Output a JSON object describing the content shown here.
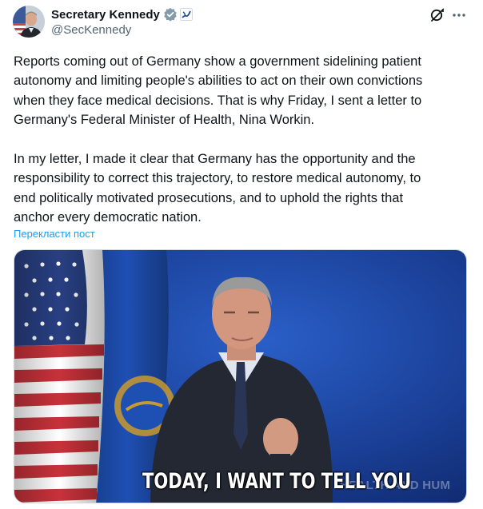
{
  "author": {
    "display_name": "Secretary Kennedy",
    "handle": "@SecKennedy",
    "avatar_icon": "profile-photo",
    "verified_icon": "verified-badge-icon",
    "affiliation_icon": "hhs-affiliation-badge-icon"
  },
  "actions": {
    "grok_icon": "grok-icon",
    "more_icon": "more-options-icon"
  },
  "tweet": {
    "text": "Reports coming out of Germany show a government sidelining patient\nautonomy and limiting people's abilities to act on their own convictions\nwhen they face medical decisions. That is why Friday, I sent a letter to\nGermany's Federal Minister of Health, Nina Workin.\n\nIn my letter, I made it clear that Germany has the opportunity and the\nresponsibility to correct this trajectory, to restore medical autonomy, to\nend politically motivated prosecutions, and to uphold the rights that\nanchor every democratic nation.",
    "translate_label": "Перекласти пост"
  },
  "media": {
    "caption": "TODAY, I WANT TO TELL YOU",
    "background_text": "HEALTH AND HUM"
  },
  "colors": {
    "link": "#1d9bf0",
    "secondary_text": "#536471",
    "backdrop_blue": "#1a3f96"
  }
}
